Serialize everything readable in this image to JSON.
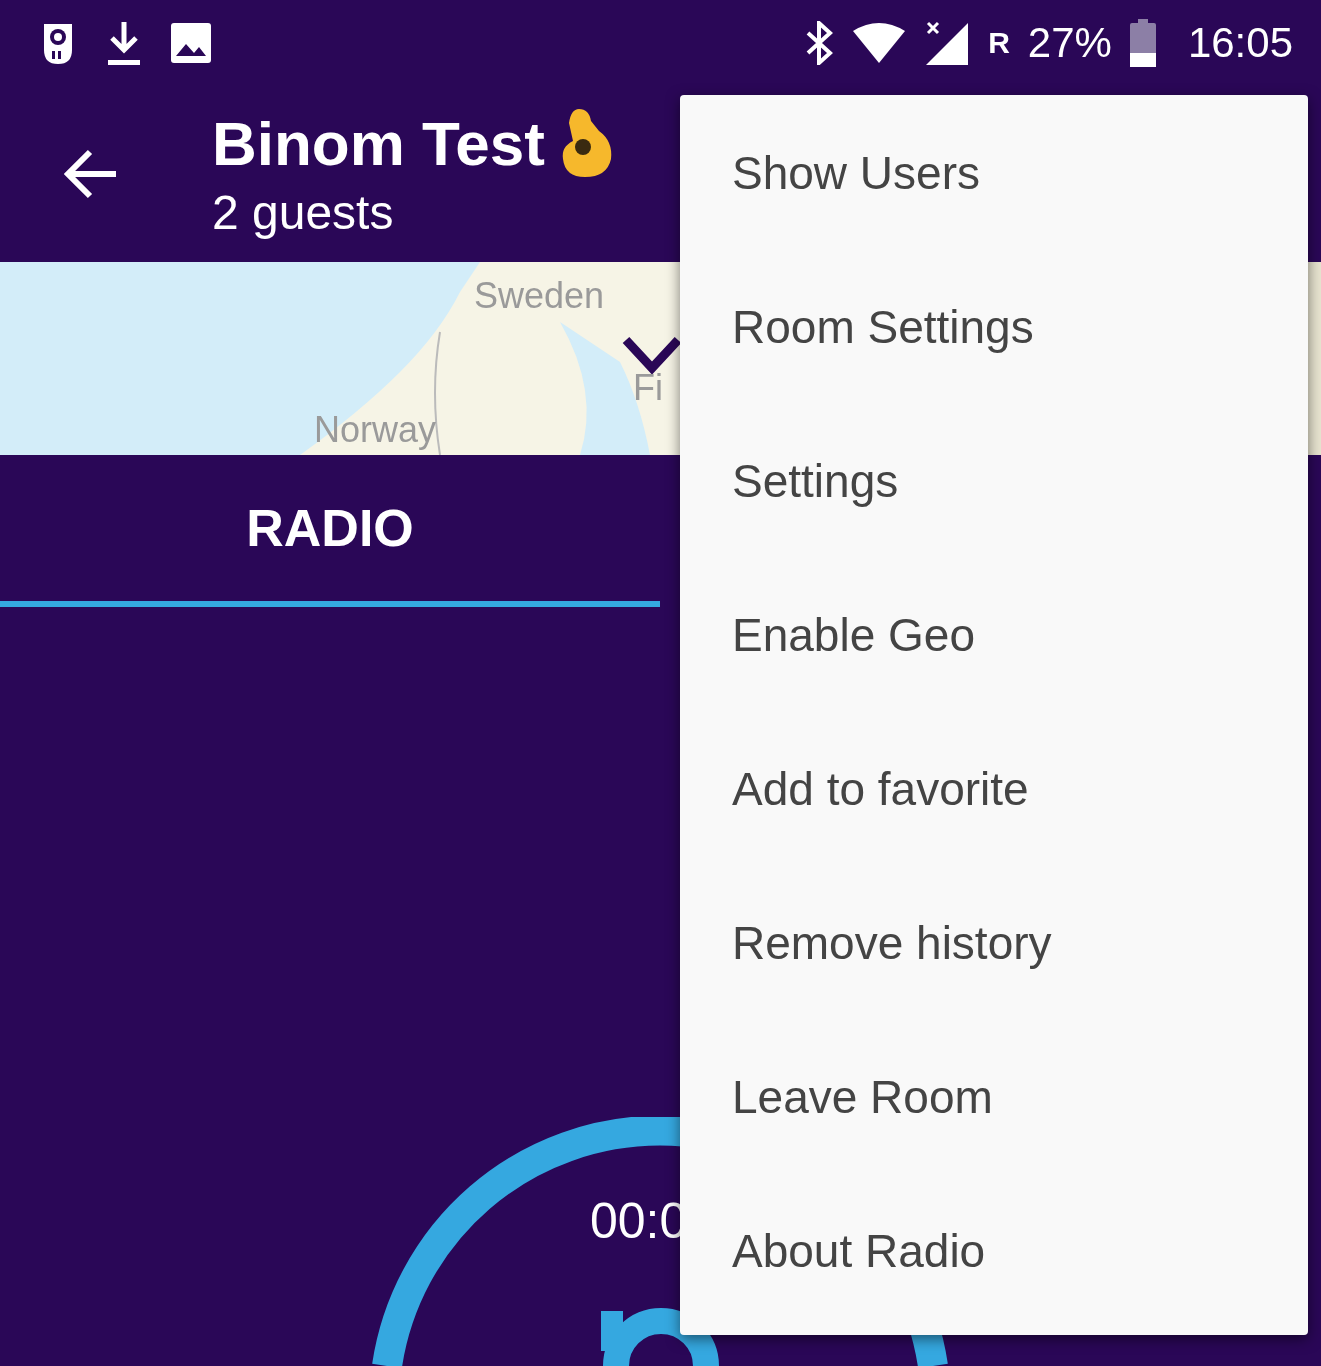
{
  "status_bar": {
    "carrier_mark": "R",
    "battery": "27%",
    "time": "16:05"
  },
  "header": {
    "title": "Binom Test",
    "subtitle": "2 guests"
  },
  "map": {
    "labels": [
      {
        "text": "Sweden"
      },
      {
        "text": "Norway"
      },
      {
        "text": "Fi"
      }
    ]
  },
  "tabs": [
    {
      "label": "RADIO",
      "selected": true
    }
  ],
  "player": {
    "timer": "00:0"
  },
  "menu": {
    "items": [
      {
        "label": "Show Users"
      },
      {
        "label": "Room Settings"
      },
      {
        "label": "Settings"
      },
      {
        "label": "Enable Geo"
      },
      {
        "label": "Add to favorite"
      },
      {
        "label": "Remove history"
      },
      {
        "label": "Leave Room"
      },
      {
        "label": "About Radio"
      }
    ]
  }
}
